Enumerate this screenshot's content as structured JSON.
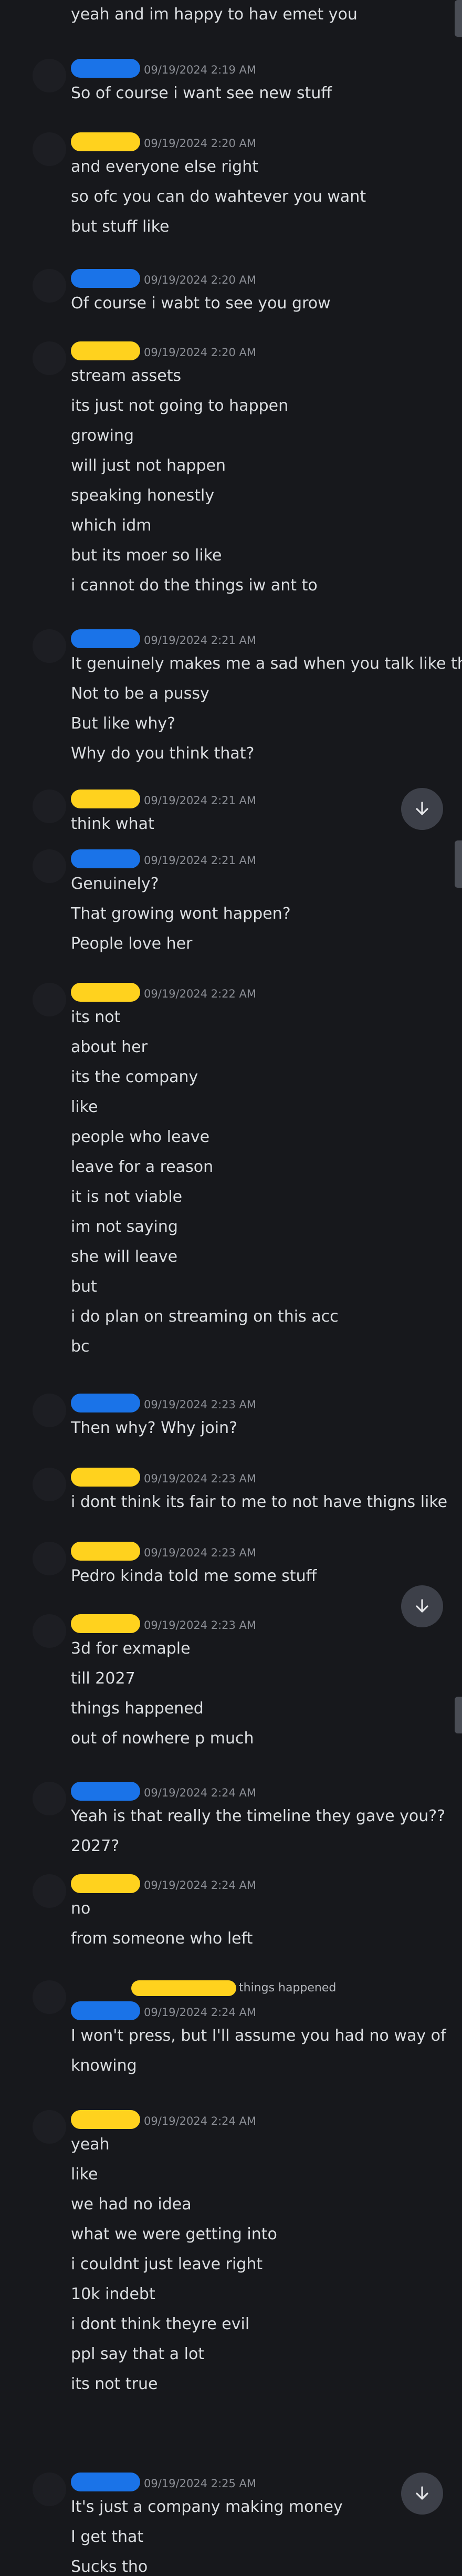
{
  "colors": {
    "blue": "#1a73e8",
    "yellow": "#ffd21e",
    "text": "#dbdee1",
    "time": "#8b8e95",
    "bg": "#17181c"
  },
  "top_line": "yeah and im happy to hav emet you",
  "messages": [
    {
      "color": "blue",
      "time": "09/19/2024 2:19 AM",
      "lines": [
        "So of course i want see new stuff"
      ]
    },
    {
      "color": "yellow",
      "time": "09/19/2024 2:20 AM",
      "lines": [
        "and everyone else right",
        "so ofc you can do wahtever you want",
        "but stuff like"
      ]
    },
    {
      "color": "blue",
      "time": "09/19/2024 2:20 AM",
      "lines": [
        "Of course i wabt to see you grow"
      ]
    },
    {
      "color": "yellow",
      "time": "09/19/2024 2:20 AM",
      "lines": [
        "stream assets",
        "its just not going to happen",
        "growing",
        "will just not happen",
        "speaking honestly",
        "which idm",
        "but its moer so like",
        "i cannot do the things iw ant to"
      ]
    },
    {
      "color": "blue",
      "time": "09/19/2024 2:21 AM",
      "lines": [
        "It genuinely makes me a sad when you talk like that",
        "Not to be a pussy",
        "But like why?",
        "Why do you think that?"
      ]
    },
    {
      "color": "yellow",
      "time": "09/19/2024 2:21 AM",
      "lines": [
        "think what"
      ]
    },
    {
      "color": "blue",
      "time": "09/19/2024 2:21 AM",
      "lines": [
        "Genuinely?",
        "That growing wont happen?",
        "People love her"
      ]
    },
    {
      "color": "yellow",
      "time": "09/19/2024 2:22 AM",
      "lines": [
        "its not",
        "about her",
        "its the company",
        "like",
        "people who leave",
        "leave for a reason",
        "it is not viable",
        "im not saying",
        "she will leave",
        "but",
        "i do plan on streaming on this acc",
        "bc"
      ]
    },
    {
      "color": "blue",
      "time": "09/19/2024 2:23 AM",
      "lines": [
        "Then why? Why join?"
      ]
    },
    {
      "color": "yellow",
      "time": "09/19/2024 2:23 AM",
      "lines": [
        "i dont think its fair to me to not have thigns like"
      ]
    },
    {
      "color": "yellow",
      "time": "09/19/2024 2:23 AM",
      "lines": [
        "Pedro kinda told me some stuff"
      ]
    },
    {
      "color": "yellow",
      "time": "09/19/2024 2:23 AM",
      "lines": [
        "3d for exmaple",
        "till 2027",
        "things happened",
        "out of nowhere p much"
      ]
    },
    {
      "color": "blue",
      "time": "09/19/2024 2:24 AM",
      "lines": [
        "Yeah is that really the timeline they gave you??",
        "2027?"
      ]
    },
    {
      "color": "yellow",
      "time": "09/19/2024 2:24 AM",
      "lines": [
        "no",
        "from someone who left"
      ]
    },
    {
      "color": "blue",
      "time": "09/19/2024 2:24 AM",
      "reply": "things happened",
      "lines": [
        "I won't press, but I'll assume you had no way of",
        "knowing"
      ]
    },
    {
      "color": "yellow",
      "time": "09/19/2024 2:24 AM",
      "lines": [
        "yeah",
        "like",
        "we had no idea",
        "what we were getting into",
        "i couldnt just leave right",
        "10k indebt",
        "i dont think theyre evil",
        "ppl say that a lot",
        "its not true"
      ]
    },
    {
      "color": "blue",
      "time": "09/19/2024 2:25 AM",
      "lines": [
        "It's just a company making money",
        "I get that",
        "Sucks tho"
      ]
    }
  ]
}
